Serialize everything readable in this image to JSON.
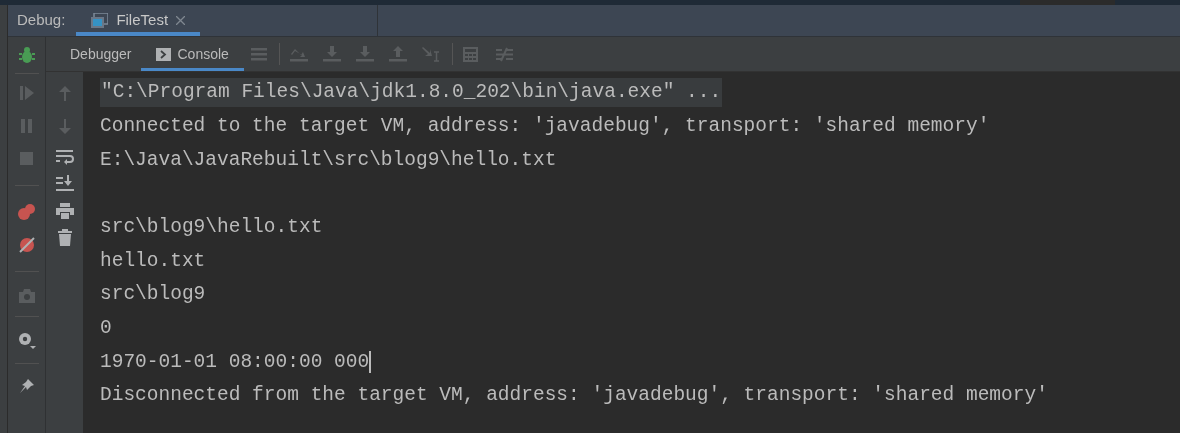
{
  "header": {
    "label": "Debug:",
    "tabs": [
      {
        "title": "FileTest",
        "selected": true
      }
    ]
  },
  "subtabs": [
    {
      "label": "Debugger",
      "selected": false
    },
    {
      "label": "Console",
      "selected": true
    }
  ],
  "console": {
    "lines": [
      {
        "kind": "command",
        "text": "\"C:\\Program Files\\Java\\jdk1.8.0_202\\bin\\java.exe\" ..."
      },
      {
        "kind": "output",
        "text": "Connected to the target VM, address: 'javadebug', transport: 'shared memory'"
      },
      {
        "kind": "output",
        "text": "E:\\Java\\JavaRebuilt\\src\\blog9\\hello.txt"
      },
      {
        "kind": "blank"
      },
      {
        "kind": "output",
        "text": "src\\blog9\\hello.txt"
      },
      {
        "kind": "output",
        "text": "hello.txt"
      },
      {
        "kind": "output",
        "text": "src\\blog9"
      },
      {
        "kind": "output",
        "text": "0"
      },
      {
        "kind": "output",
        "text": "1970-01-01 08:00:00 000",
        "cursor": true
      },
      {
        "kind": "output",
        "text": "Disconnected from the target VM, address: 'javadebug', transport: 'shared memory'"
      }
    ]
  }
}
